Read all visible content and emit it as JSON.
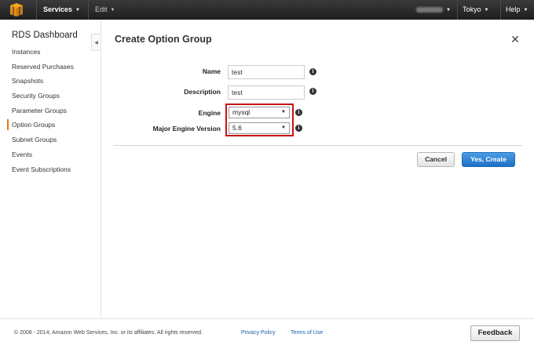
{
  "topbar": {
    "services_label": "Services",
    "edit_label": "Edit",
    "region_label": "Tokyo",
    "help_label": "Help"
  },
  "sidebar": {
    "title": "RDS Dashboard",
    "items": [
      {
        "label": "Instances"
      },
      {
        "label": "Reserved Purchases"
      },
      {
        "label": "Snapshots"
      },
      {
        "label": "Security Groups"
      },
      {
        "label": "Parameter Groups"
      },
      {
        "label": "Option Groups"
      },
      {
        "label": "Subnet Groups"
      },
      {
        "label": "Events"
      },
      {
        "label": "Event Subscriptions"
      }
    ],
    "active_item": "Option Groups"
  },
  "dialog": {
    "title": "Create Option Group",
    "close_glyph": "✕",
    "fields": {
      "name": {
        "label": "Name",
        "value": "test"
      },
      "description": {
        "label": "Description",
        "value": "test"
      },
      "engine": {
        "label": "Engine",
        "value": "mysql"
      },
      "major_engine_version": {
        "label": "Major Engine Version",
        "value": "5.6"
      }
    },
    "cancel_label": "Cancel",
    "create_label": "Yes, Create"
  },
  "footer": {
    "copyright": "© 2008 - 2014, Amazon Web Services, Inc. or its affiliates. All rights reserved.",
    "privacy_label": "Privacy Policy",
    "terms_label": "Terms of Use",
    "feedback_label": "Feedback"
  },
  "colors": {
    "topbar": "#2b2b2b",
    "accent_orange": "#e47911",
    "primary_button": "#2a7ad2",
    "highlight_red": "#cc1111",
    "link_blue": "#1a5fa8"
  },
  "icons": {
    "logo": "aws-cube-logo-icon",
    "info": "info-icon",
    "dropdown": "caret-down-icon",
    "close": "close-icon",
    "collapse": "chevron-left-icon"
  }
}
